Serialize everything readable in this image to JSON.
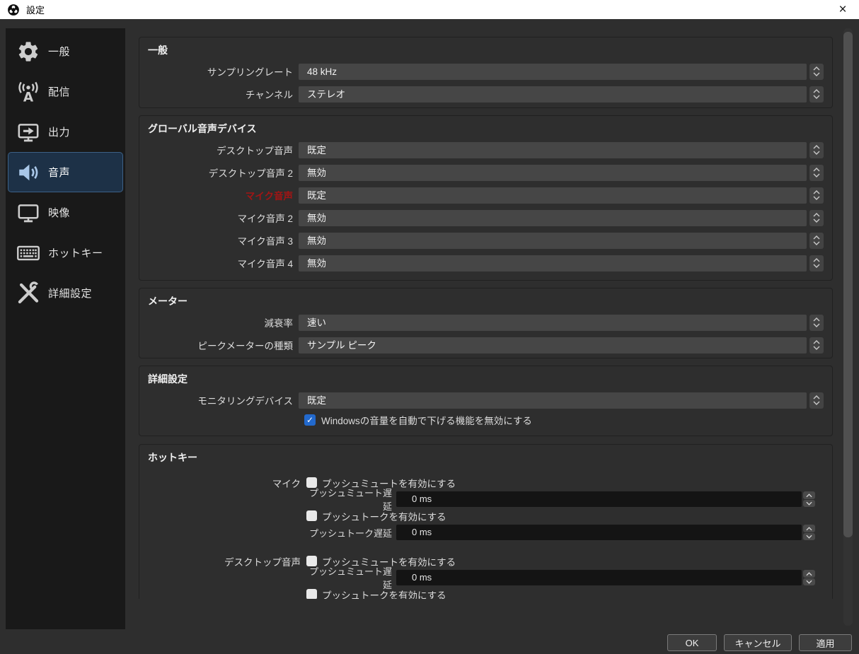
{
  "window": {
    "title": "設定",
    "close_glyph": "×"
  },
  "sidebar": {
    "items": [
      {
        "label": "一般",
        "icon": "gear-icon",
        "selected": false
      },
      {
        "label": "配信",
        "icon": "broadcast-icon",
        "selected": false
      },
      {
        "label": "出力",
        "icon": "output-icon",
        "selected": false
      },
      {
        "label": "音声",
        "icon": "audio-icon",
        "selected": true
      },
      {
        "label": "映像",
        "icon": "video-icon",
        "selected": false
      },
      {
        "label": "ホットキー",
        "icon": "keyboard-icon",
        "selected": false
      },
      {
        "label": "詳細設定",
        "icon": "tools-icon",
        "selected": false
      }
    ]
  },
  "sections": {
    "general": {
      "title": "一般",
      "rows": [
        {
          "label": "サンプリングレート",
          "value": "48 kHz"
        },
        {
          "label": "チャンネル",
          "value": "ステレオ"
        }
      ]
    },
    "global_audio": {
      "title": "グローバル音声デバイス",
      "rows": [
        {
          "label": "デスクトップ音声",
          "value": "既定",
          "alert": false
        },
        {
          "label": "デスクトップ音声 2",
          "value": "無効",
          "alert": false
        },
        {
          "label": "マイク音声",
          "value": "既定",
          "alert": true
        },
        {
          "label": "マイク音声 2",
          "value": "無効",
          "alert": false
        },
        {
          "label": "マイク音声 3",
          "value": "無効",
          "alert": false
        },
        {
          "label": "マイク音声 4",
          "value": "無効",
          "alert": false
        }
      ]
    },
    "meters": {
      "title": "メーター",
      "rows": [
        {
          "label": "減衰率",
          "value": "速い"
        },
        {
          "label": "ピークメーターの種類",
          "value": "サンプル ピーク"
        }
      ]
    },
    "advanced": {
      "title": "詳細設定",
      "rows": [
        {
          "label": "モニタリングデバイス",
          "value": "既定"
        }
      ],
      "checkbox": {
        "label": "Windowsの音量を自動で下げる機能を無効にする",
        "checked": true
      }
    },
    "hotkeys": {
      "title": "ホットキー",
      "groups": [
        {
          "label": "マイク",
          "items": [
            {
              "type": "checkbox",
              "label": "プッシュミュートを有効にする",
              "checked": false
            },
            {
              "type": "spinbox",
              "label": "プッシュミュート遅延",
              "value": "0 ms"
            },
            {
              "type": "checkbox",
              "label": "プッシュトークを有効にする",
              "checked": false
            },
            {
              "type": "spinbox",
              "label": "プッシュトーク遅延",
              "value": "0 ms"
            }
          ]
        },
        {
          "label": "デスクトップ音声",
          "items": [
            {
              "type": "checkbox",
              "label": "プッシュミュートを有効にする",
              "checked": false
            },
            {
              "type": "spinbox",
              "label": "プッシュミュート遅延",
              "value": "0 ms"
            },
            {
              "type": "checkbox",
              "label": "プッシュトークを有効にする",
              "checked": false,
              "clipped": true
            }
          ]
        }
      ]
    }
  },
  "footer": {
    "buttons": [
      {
        "label": "OK"
      },
      {
        "label": "キャンセル"
      },
      {
        "label": "適用"
      }
    ]
  },
  "colors": {
    "titlebar_bg": "#ffffff",
    "window_bg": "#2e2e2e",
    "sidebar_bg": "#191919",
    "selected_item_bg": "#1d3147",
    "selected_item_border": "#3c6186",
    "selected_icon": "#a9c7e8",
    "alert_label": "#a31414",
    "checkbox_checked": "#2269cd",
    "combo_bg": "#464646",
    "spin_field_bg": "#141414"
  }
}
